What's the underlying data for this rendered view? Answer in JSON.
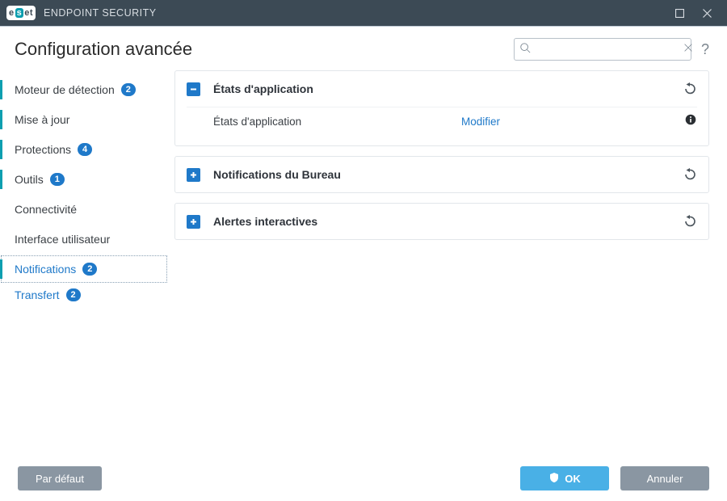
{
  "window": {
    "title": "ENDPOINT SECURITY",
    "brand_left": "e",
    "brand_mid": "s",
    "brand_right": "et"
  },
  "page": {
    "title": "Configuration avancée"
  },
  "search": {
    "placeholder": ""
  },
  "sidebar": {
    "items": [
      {
        "label": "Moteur de détection",
        "badge": "2",
        "accent": true
      },
      {
        "label": "Mise à jour",
        "badge": "",
        "accent": true
      },
      {
        "label": "Protections",
        "badge": "4",
        "accent": true
      },
      {
        "label": "Outils",
        "badge": "1",
        "accent": true
      },
      {
        "label": "Connectivité",
        "badge": "",
        "accent": false
      },
      {
        "label": "Interface utilisateur",
        "badge": "",
        "accent": false
      },
      {
        "label": "Notifications",
        "badge": "2",
        "accent": true,
        "selected": true
      }
    ],
    "sub": [
      {
        "label": "Transfert",
        "badge": "2"
      }
    ]
  },
  "panels": {
    "app_states": {
      "title": "États d'application",
      "row_label": "États d'application",
      "row_action": "Modifier"
    },
    "desktop": {
      "title": "Notifications du Bureau"
    },
    "interactive": {
      "title": "Alertes interactives"
    }
  },
  "footer": {
    "default": "Par défaut",
    "ok": "OK",
    "cancel": "Annuler"
  }
}
